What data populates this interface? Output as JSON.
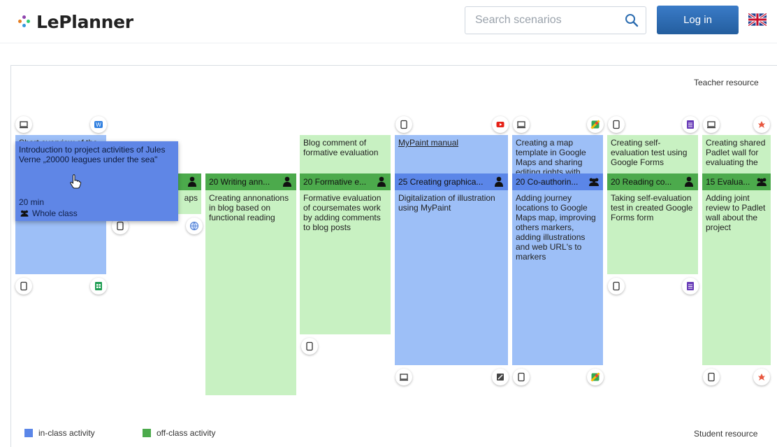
{
  "header": {
    "logo_text": "LePlanner",
    "search_placeholder": "Search scenarios",
    "login_label": "Log in",
    "language_flag": "uk-flag-icon"
  },
  "labels": {
    "teacher_resource": "Teacher resource",
    "student_resource": "Student resource"
  },
  "legend": [
    {
      "label": "in-class activity",
      "color": "#5b86e8"
    },
    {
      "label": "off-class activity",
      "color": "#4caa4c"
    }
  ],
  "colors": {
    "in_class_card": "#9dbff7",
    "in_class_bar": "#5b86e8",
    "off_class_card": "#c8f1c2",
    "off_class_bar": "#4caa4c",
    "login_button": "#2b6cb0"
  },
  "popup": {
    "title": "Introduction to project activities of Jules Verne „20000 leagues under the sea\"",
    "duration": "20 min",
    "group": "Whole class"
  },
  "activities": [
    {
      "type": "in-class",
      "top_text": "Short overview of the",
      "bar": "",
      "lower_text": "",
      "top_icons": [
        "laptop-icon",
        "word-icon"
      ],
      "bottom_icons": [
        "tablet-icon",
        "sheets-icon"
      ]
    },
    {
      "type": "off-class",
      "top_text": "",
      "bar": "",
      "lower_text": "aps",
      "bottom_icons": [
        "tablet-icon",
        "browser-icon"
      ]
    },
    {
      "type": "off-class",
      "top_text": "",
      "bar": "20 Writing ann...",
      "lower_text": "Creating annonations in blog based on functional reading",
      "bar_icon": "person-icon"
    },
    {
      "type": "off-class",
      "top_text": "Blog comment of formative evaluation",
      "bar": "20 Formative e...",
      "lower_text": "Formative evaluation of coursemates work by adding comments to blog posts",
      "bar_icon": "person-icon",
      "bottom_icons": [
        "tablet-icon"
      ]
    },
    {
      "type": "in-class",
      "top_text": "MyPaint manual",
      "bar": "25 Creating graphica...",
      "lower_text": "Digitalization of illustration using MyPaint",
      "bar_icon": "person-icon",
      "top_icons": [
        "tablet-icon",
        "youtube-icon"
      ],
      "bottom_icons": [
        "laptop-icon",
        "mypaint-icon"
      ]
    },
    {
      "type": "in-class",
      "top_text": "Creating a map template in Google Maps and sharing editing rights with",
      "bar": "20 Co-authorin...",
      "lower_text": "Adding journey locations to Google Maps map, improving others markers, adding illustrations and web URL's to markers",
      "bar_icon": "group-icon",
      "top_icons": [
        "laptop-icon",
        "maps-icon"
      ],
      "bottom_icons": [
        "tablet-icon",
        "maps-icon"
      ]
    },
    {
      "type": "off-class",
      "top_text": "Creating self-evaluation test using Google Forms",
      "bar": "20 Reading co...",
      "lower_text": "Taking self-evaluation test in created Google Forms form",
      "bar_icon": "person-icon",
      "top_icons": [
        "tablet-icon",
        "forms-icon"
      ],
      "bottom_icons": [
        "tablet-icon",
        "forms-icon"
      ]
    },
    {
      "type": "off-class",
      "top_text": "Creating shared Padlet wall for evaluating the",
      "bar": "15 Evalua...",
      "lower_text": "Adding joint review to Padlet wall about the project",
      "bar_icon": "group-icon",
      "top_icons": [
        "laptop-icon",
        "padlet-icon"
      ],
      "bottom_icons": [
        "tablet-icon",
        "padlet-icon"
      ]
    }
  ]
}
